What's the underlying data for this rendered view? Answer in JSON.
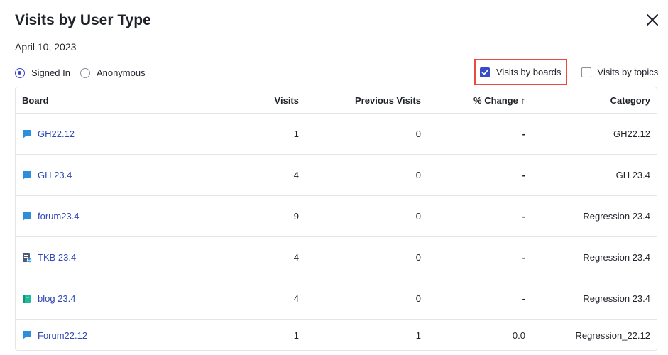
{
  "dialog": {
    "title": "Visits by User Type",
    "date": "April 10, 2023"
  },
  "user_type": {
    "options": [
      {
        "label": "Signed In",
        "selected": true
      },
      {
        "label": "Anonymous",
        "selected": false
      }
    ]
  },
  "view_mode": {
    "options": [
      {
        "label": "Visits by boards",
        "checked": true
      },
      {
        "label": "Visits by topics",
        "checked": false
      }
    ]
  },
  "table": {
    "headers": {
      "board": "Board",
      "visits": "Visits",
      "previous_visits": "Previous Visits",
      "change": "% Change",
      "category": "Category"
    },
    "sort_indicator": "↑",
    "rows": [
      {
        "icon": "forum-icon",
        "board": "GH22.12",
        "visits": "1",
        "previous_visits": "0",
        "change": "-",
        "category": "GH22.12"
      },
      {
        "icon": "forum-icon",
        "board": "GH 23.4",
        "visits": "4",
        "previous_visits": "0",
        "change": "-",
        "category": "GH 23.4"
      },
      {
        "icon": "forum-icon",
        "board": "forum23.4",
        "visits": "9",
        "previous_visits": "0",
        "change": "-",
        "category": "Regression 23.4"
      },
      {
        "icon": "tkb-icon",
        "board": "TKB 23.4",
        "visits": "4",
        "previous_visits": "0",
        "change": "-",
        "category": "Regression 23.4"
      },
      {
        "icon": "blog-icon",
        "board": "blog 23.4",
        "visits": "4",
        "previous_visits": "0",
        "change": "-",
        "category": "Regression 23.4"
      },
      {
        "icon": "forum-icon",
        "board": "Forum22.12",
        "visits": "1",
        "previous_visits": "1",
        "change": "0.0",
        "category": "Regression_22.12"
      }
    ]
  },
  "colors": {
    "accent": "#3a4bc7",
    "link": "#2f49b8",
    "highlight_border": "#e74c3c",
    "forum_icon": "#2d8fdc",
    "blog_icon": "#1fb89a",
    "tkb_icon": "#4a5a78"
  }
}
